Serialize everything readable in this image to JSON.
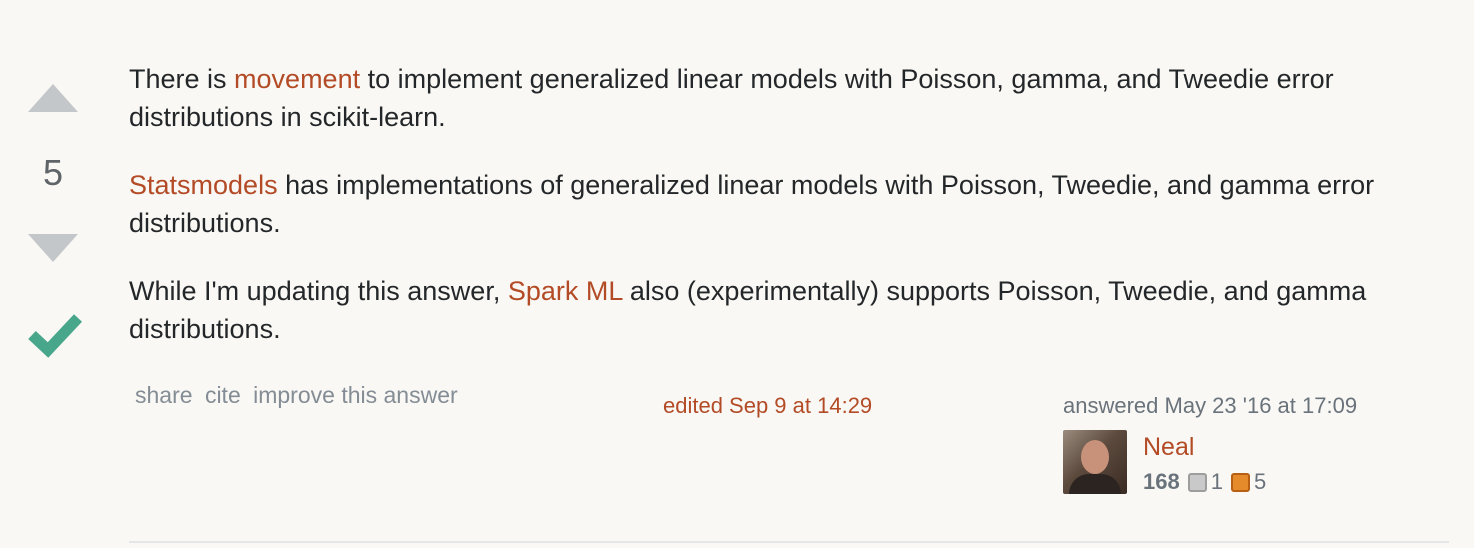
{
  "votes": {
    "count": "5",
    "accepted": true,
    "accent_color": "#48a68b"
  },
  "post": {
    "p1_prefix": "There is ",
    "p1_link": "movement",
    "p1_suffix": " to implement generalized linear models with Poisson, gamma, and Tweedie error distributions in scikit-learn.",
    "p2_link": "Statsmodels",
    "p2_suffix": " has implementations of generalized linear models with Poisson, Tweedie, and gamma error distributions.",
    "p3_prefix": "While I'm updating this answer, ",
    "p3_link": "Spark ML",
    "p3_suffix": " also (experimentally) supports Poisson, Tweedie, and gamma distributions."
  },
  "menu": {
    "share": "share",
    "cite": "cite",
    "improve": "improve this answer"
  },
  "edited": "edited Sep 9 at 14:29",
  "signature": {
    "answered": "answered May 23 '16 at 17:09",
    "user_name": "Neal",
    "reputation": "168",
    "silver_badges": "1",
    "bronze_badges": "5"
  },
  "colors": {
    "link": "#b34b26",
    "muted": "#848d95",
    "background": "#f9f8f4"
  }
}
